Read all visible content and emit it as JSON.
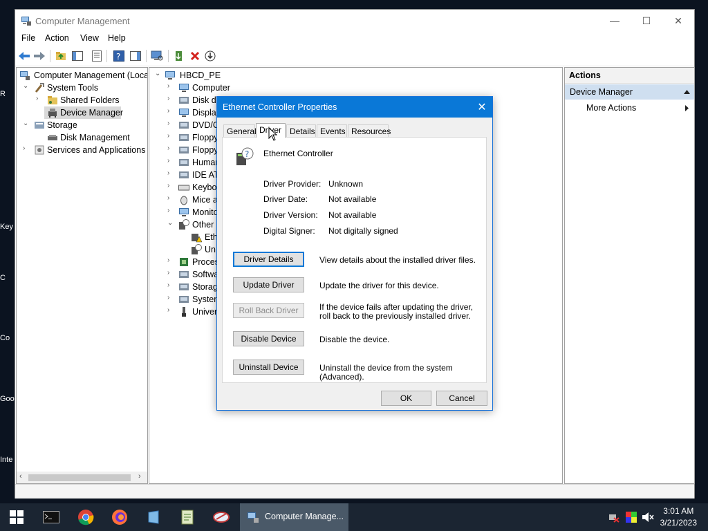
{
  "desktop": {
    "fragments": [
      "R",
      "Key",
      "C",
      "Co",
      "Goo",
      "Inte"
    ]
  },
  "window": {
    "title": "Computer Management",
    "controls": {
      "minimize": "—",
      "maximize": "☐",
      "close": "✕"
    },
    "menu": [
      "File",
      "Action",
      "View",
      "Help"
    ]
  },
  "left_tree": [
    {
      "label": "Computer Management (Local",
      "icon": "computer-management-icon"
    },
    {
      "label": "System Tools",
      "icon": "tools-icon"
    },
    {
      "label": "Shared Folders",
      "icon": "shared-folder-icon"
    },
    {
      "label": "Device Manager",
      "icon": "device-manager-icon"
    },
    {
      "label": "Storage",
      "icon": "storage-icon"
    },
    {
      "label": "Disk Management",
      "icon": "disk-icon"
    },
    {
      "label": "Services and Applications",
      "icon": "services-icon"
    }
  ],
  "device_tree": [
    {
      "label": "HBCD_PE",
      "icon": "computer-icon"
    },
    {
      "label": "Computer",
      "icon": "monitor-icon"
    },
    {
      "label": "Disk dr",
      "icon": "disk-drive-icon"
    },
    {
      "label": "Display",
      "icon": "display-icon"
    },
    {
      "label": "DVD/C",
      "icon": "dvd-icon"
    },
    {
      "label": "Floppy",
      "icon": "floppy-icon"
    },
    {
      "label": "Floppy",
      "icon": "floppy-controller-icon"
    },
    {
      "label": "Human",
      "icon": "hid-icon"
    },
    {
      "label": "IDE ATA",
      "icon": "ide-icon"
    },
    {
      "label": "Keyboa",
      "icon": "keyboard-icon"
    },
    {
      "label": "Mice a",
      "icon": "mouse-icon"
    },
    {
      "label": "Monito",
      "icon": "monitor-icon"
    },
    {
      "label": "Other d",
      "icon": "unknown-device-icon"
    },
    {
      "label": "Eth",
      "icon": "warning-device-icon"
    },
    {
      "label": "Un",
      "icon": "unknown-device-icon"
    },
    {
      "label": "Proces",
      "icon": "processor-icon"
    },
    {
      "label": "Softwa",
      "icon": "software-icon"
    },
    {
      "label": "Storag",
      "icon": "storage-controller-icon"
    },
    {
      "label": "System",
      "icon": "system-icon"
    },
    {
      "label": "Univer",
      "icon": "usb-icon"
    }
  ],
  "actions": {
    "header": "Actions",
    "section": "Device Manager",
    "more": "More Actions"
  },
  "dialog": {
    "title": "Ethernet Controller Properties",
    "tabs": [
      "General",
      "Driver",
      "Details",
      "Events",
      "Resources"
    ],
    "device_name": "Ethernet Controller",
    "props": [
      {
        "label": "Driver Provider:",
        "value": "Unknown"
      },
      {
        "label": "Driver Date:",
        "value": "Not available"
      },
      {
        "label": "Driver Version:",
        "value": "Not available"
      },
      {
        "label": "Digital Signer:",
        "value": "Not digitally signed"
      }
    ],
    "buttons": [
      {
        "label": "Driver Details",
        "desc": "View details about the installed driver files."
      },
      {
        "label": "Update Driver",
        "desc": "Update the driver for this device."
      },
      {
        "label": "Roll Back Driver",
        "desc": "If the device fails after updating the driver, roll back to the previously installed driver."
      },
      {
        "label": "Disable Device",
        "desc": "Disable the device."
      },
      {
        "label": "Uninstall Device",
        "desc": "Uninstall the device from the system (Advanced)."
      }
    ],
    "ok": "OK",
    "cancel": "Cancel"
  },
  "taskbar": {
    "active_item": "Computer Manage...",
    "time": "3:01 AM",
    "date": "3/21/2023"
  },
  "colors": {
    "accent": "#0a78d7",
    "taskbar": "#1b2532",
    "selection": "#cfdff0"
  }
}
